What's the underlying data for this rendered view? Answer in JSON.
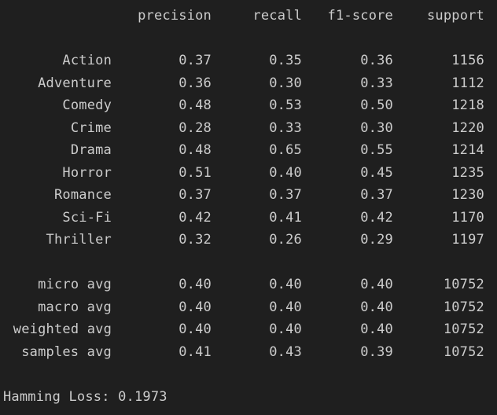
{
  "report": {
    "headers": [
      "precision",
      "recall",
      "f1-score",
      "support"
    ],
    "rows": [
      {
        "label": "Action",
        "precision": "0.37",
        "recall": "0.35",
        "f1": "0.36",
        "support": "1156"
      },
      {
        "label": "Adventure",
        "precision": "0.36",
        "recall": "0.30",
        "f1": "0.33",
        "support": "1112"
      },
      {
        "label": "Comedy",
        "precision": "0.48",
        "recall": "0.53",
        "f1": "0.50",
        "support": "1218"
      },
      {
        "label": "Crime",
        "precision": "0.28",
        "recall": "0.33",
        "f1": "0.30",
        "support": "1220"
      },
      {
        "label": "Drama",
        "precision": "0.48",
        "recall": "0.65",
        "f1": "0.55",
        "support": "1214"
      },
      {
        "label": "Horror",
        "precision": "0.51",
        "recall": "0.40",
        "f1": "0.45",
        "support": "1235"
      },
      {
        "label": "Romance",
        "precision": "0.37",
        "recall": "0.37",
        "f1": "0.37",
        "support": "1230"
      },
      {
        "label": "Sci-Fi",
        "precision": "0.42",
        "recall": "0.41",
        "f1": "0.42",
        "support": "1170"
      },
      {
        "label": "Thriller",
        "precision": "0.32",
        "recall": "0.26",
        "f1": "0.29",
        "support": "1197"
      }
    ],
    "averages": [
      {
        "label": "micro avg",
        "precision": "0.40",
        "recall": "0.40",
        "f1": "0.40",
        "support": "10752"
      },
      {
        "label": "macro avg",
        "precision": "0.40",
        "recall": "0.40",
        "f1": "0.40",
        "support": "10752"
      },
      {
        "label": "weighted avg",
        "precision": "0.40",
        "recall": "0.40",
        "f1": "0.40",
        "support": "10752"
      },
      {
        "label": "samples avg",
        "precision": "0.41",
        "recall": "0.43",
        "f1": "0.39",
        "support": "10752"
      }
    ]
  },
  "hamming": {
    "text": "Hamming Loss: 0.1973"
  },
  "theme": {
    "background": "#1f1f1f",
    "text_color": "#cccccc"
  }
}
